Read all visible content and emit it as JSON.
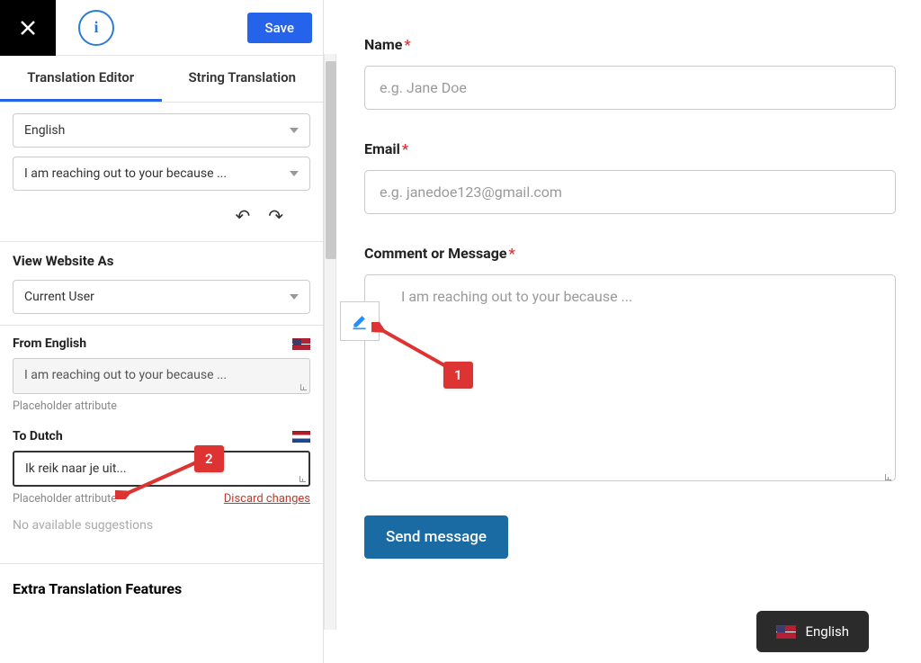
{
  "header": {
    "save_label": "Save"
  },
  "tabs": {
    "editor": "Translation Editor",
    "string": "String Translation"
  },
  "source_lang_select": "English",
  "string_select": "I am reaching out to your because ...",
  "view_as": {
    "title": "View Website As",
    "value": "Current User"
  },
  "from": {
    "label": "From English",
    "value": "I am reaching out to your because ...",
    "hint": "Placeholder attribute"
  },
  "to": {
    "label": "To Dutch",
    "value": "Ik reik naar je uit...",
    "hint": "Placeholder attribute",
    "discard": "Discard changes"
  },
  "suggestions": "No available suggestions",
  "extra_title": "Extra Translation Features",
  "form": {
    "name_label": "Name",
    "name_placeholder": "e.g. Jane Doe",
    "email_label": "Email",
    "email_placeholder": "e.g. janedoe123@gmail.com",
    "message_label": "Comment or Message",
    "message_placeholder": "I am reaching out to your because ...",
    "submit": "Send message"
  },
  "callouts": {
    "one": "1",
    "two": "2"
  },
  "lang_switcher": "English"
}
